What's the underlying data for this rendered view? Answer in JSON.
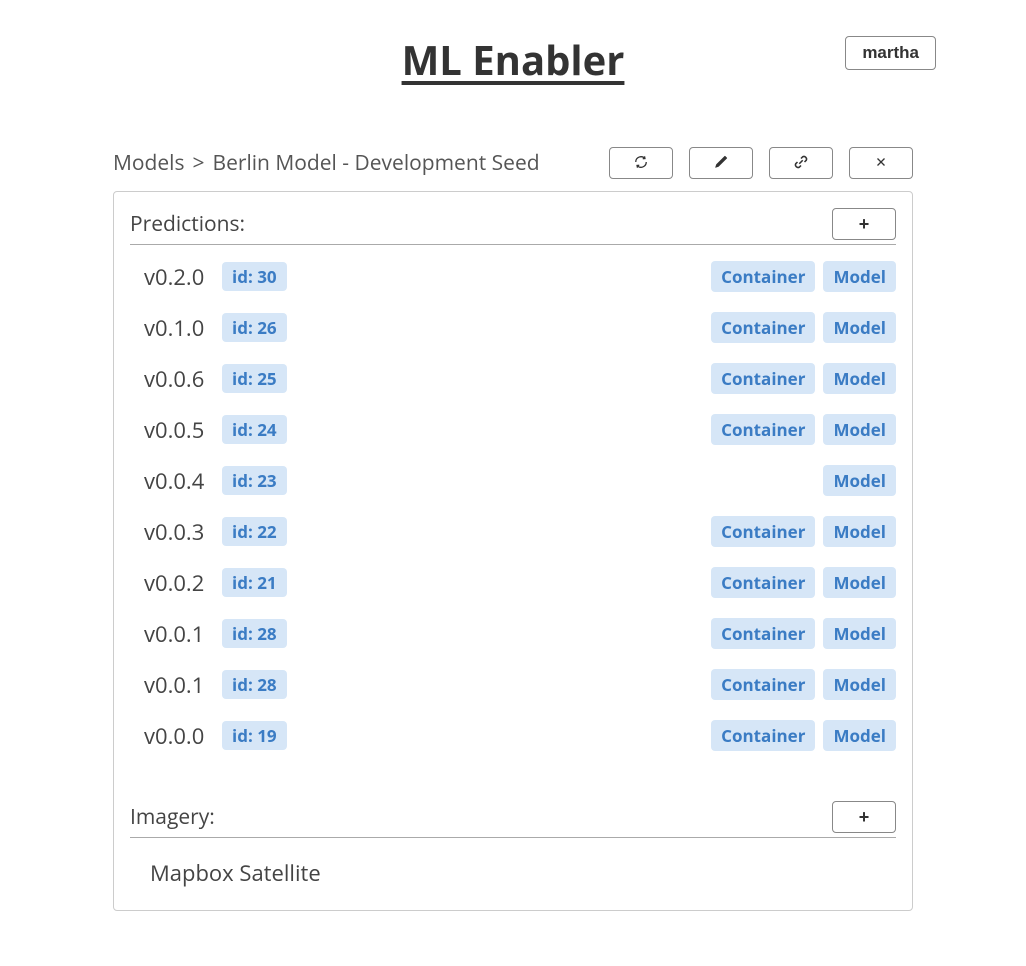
{
  "header": {
    "title": "ML Enabler",
    "user": "martha"
  },
  "breadcrumb": {
    "root": "Models",
    "separator": ">",
    "current": "Berlin Model - Development Seed"
  },
  "toolbar": {
    "refresh": "refresh",
    "edit": "edit",
    "link": "link",
    "close": "close"
  },
  "sections": {
    "predictions": {
      "title": "Predictions:",
      "add_label": "+",
      "rows": [
        {
          "version": "v0.2.0",
          "id_label": "id: 30",
          "tags": [
            "Container",
            "Model"
          ]
        },
        {
          "version": "v0.1.0",
          "id_label": "id: 26",
          "tags": [
            "Container",
            "Model"
          ]
        },
        {
          "version": "v0.0.6",
          "id_label": "id: 25",
          "tags": [
            "Container",
            "Model"
          ]
        },
        {
          "version": "v0.0.5",
          "id_label": "id: 24",
          "tags": [
            "Container",
            "Model"
          ]
        },
        {
          "version": "v0.0.4",
          "id_label": "id: 23",
          "tags": [
            "Model"
          ]
        },
        {
          "version": "v0.0.3",
          "id_label": "id: 22",
          "tags": [
            "Container",
            "Model"
          ]
        },
        {
          "version": "v0.0.2",
          "id_label": "id: 21",
          "tags": [
            "Container",
            "Model"
          ]
        },
        {
          "version": "v0.0.1",
          "id_label": "id: 28",
          "tags": [
            "Container",
            "Model"
          ]
        },
        {
          "version": "v0.0.1",
          "id_label": "id: 28",
          "tags": [
            "Container",
            "Model"
          ]
        },
        {
          "version": "v0.0.0",
          "id_label": "id: 19",
          "tags": [
            "Container",
            "Model"
          ]
        }
      ]
    },
    "imagery": {
      "title": "Imagery:",
      "add_label": "+",
      "items": [
        "Mapbox Satellite"
      ]
    }
  }
}
